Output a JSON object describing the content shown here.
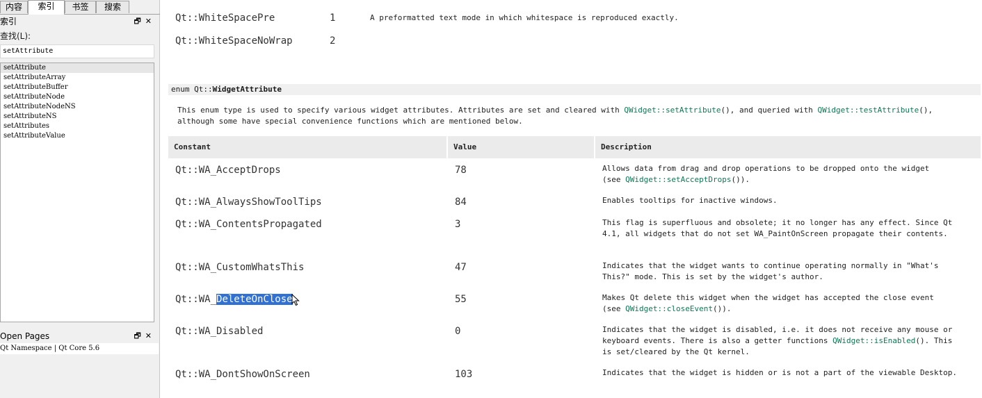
{
  "left_panel": {
    "tabs": [
      "内容",
      "索引",
      "书签",
      "搜索"
    ],
    "active_tab": "索引",
    "index_dock_title": "索引",
    "find_label": "查找(L):",
    "find_value": "setAttribute",
    "index_items": [
      "setAttribute",
      "setAttributeArray",
      "setAttributeBuffer",
      "setAttributeNode",
      "setAttributeNodeNS",
      "setAttributeNS",
      "setAttributes",
      "setAttributeValue"
    ],
    "open_pages_title": "Open Pages",
    "open_page_entry": "Qt Namespace | Qt Core 5.6",
    "dock_buttons": "🗗✕"
  },
  "content": {
    "top_rows": [
      {
        "constant": "Qt::WhiteSpacePre",
        "value": "1",
        "description": "A preformatted text mode in which whitespace is reproduced exactly."
      },
      {
        "constant": "Qt::WhiteSpaceNoWrap",
        "value": "2",
        "description": ""
      }
    ],
    "enum_prefix": "enum Qt::",
    "enum_name": "WidgetAttribute",
    "intro_line1_a": "This enum type is used to specify various widget attributes. Attributes are set and cleared with ",
    "intro_link1": "QWidget::setAttribute",
    "intro_line1_b": "(), and queried with ",
    "intro_link2": "QWidget::testAttribute",
    "intro_line1_c": "(),",
    "intro_line2": "although some have special convenience functions which are mentioned below.",
    "table_headers": {
      "constant": "Constant",
      "value": "Value",
      "description": "Description"
    },
    "rows": [
      {
        "constant": "Qt::WA_AcceptDrops",
        "value": "78",
        "desc_a": "Allows data from drag and drop operations to be dropped onto the widget",
        "desc_b": "(see ",
        "link": "QWidget::setAcceptDrops",
        "desc_c": "())."
      },
      {
        "constant": "Qt::WA_AlwaysShowToolTips",
        "value": "84",
        "desc_a": "Enables tooltips for inactive windows."
      },
      {
        "constant": "Qt::WA_ContentsPropagated",
        "value": "3",
        "desc_a": "This flag is superfluous and obsolete; it no longer has any effect. Since Qt 4.1, all widgets that do not set WA_PaintOnScreen propagate their contents."
      },
      {
        "constant": "Qt::WA_CustomWhatsThis",
        "value": "47",
        "desc_a": "Indicates that the widget wants to continue operating normally in \"What's This?\" mode. This is set by the widget's author."
      },
      {
        "constant_a": "Qt::WA_",
        "constant_sel": "DeleteOnClose",
        "value": "55",
        "desc_a": "Makes Qt delete this widget when the widget has accepted the close event",
        "desc_b": "(see ",
        "link": "QWidget::closeEvent",
        "desc_c": "())."
      },
      {
        "constant": "Qt::WA_Disabled",
        "value": "0",
        "desc_a": "Indicates that the widget is disabled, i.e. it does not receive any mouse or keyboard events. There is also a getter functions ",
        "link": "QWidget::isEnabled",
        "desc_c": "(). This is set/cleared by the Qt kernel."
      },
      {
        "constant": "Qt::WA_DontShowOnScreen",
        "value": "103",
        "desc_a": "Indicates that the widget is hidden or is not a part of the viewable Desktop."
      }
    ]
  }
}
